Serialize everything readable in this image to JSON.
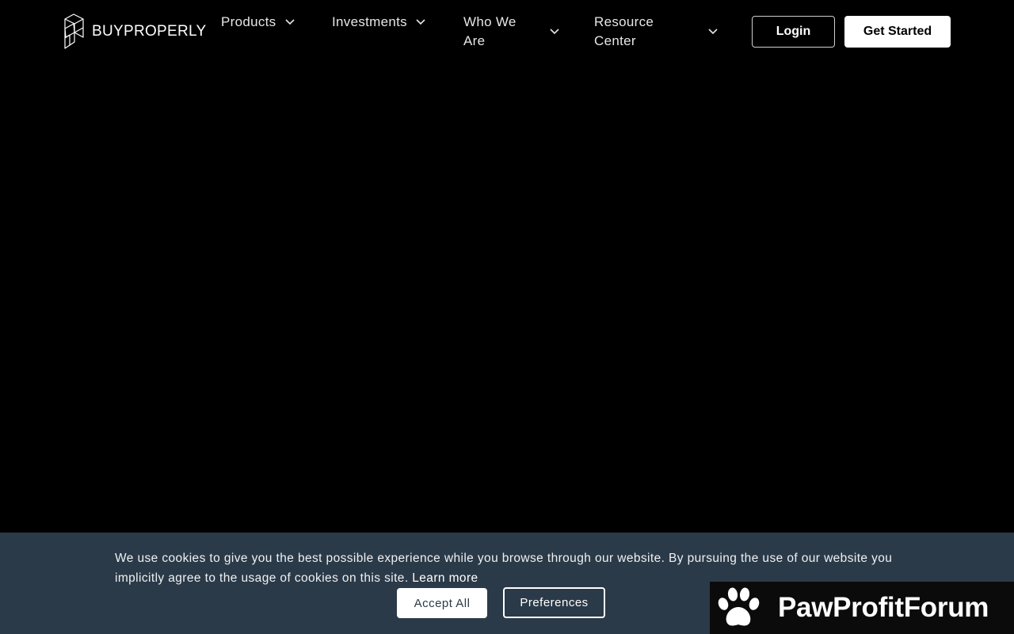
{
  "brand": {
    "name": "BUYPROPERLY",
    "logo_icon": "cube-stack-logo-icon"
  },
  "nav": {
    "items": [
      {
        "label": "Products",
        "icon": "chevron-down-icon"
      },
      {
        "label": "Investments",
        "icon": "chevron-down-icon"
      },
      {
        "label": "Who We Are",
        "icon": "chevron-down-icon"
      },
      {
        "label": "Resource Center",
        "icon": "chevron-down-icon"
      }
    ],
    "login_label": "Login",
    "get_started_label": "Get Started"
  },
  "cookie": {
    "message": "We use cookies to give you the best possible experience while you browse through our website. By pursuing the use of our website you implicitly agree to the usage of cookies on this site.",
    "learn_more": "Learn more",
    "accept_label": "Accept All",
    "preferences_label": "Preferences"
  },
  "watermark": {
    "text": "PawProfitForum",
    "icon": "paw-icon"
  },
  "colors": {
    "page_background": "#000000",
    "banner_background": "#2b3a48",
    "watermark_background": "#0b0b0b"
  }
}
